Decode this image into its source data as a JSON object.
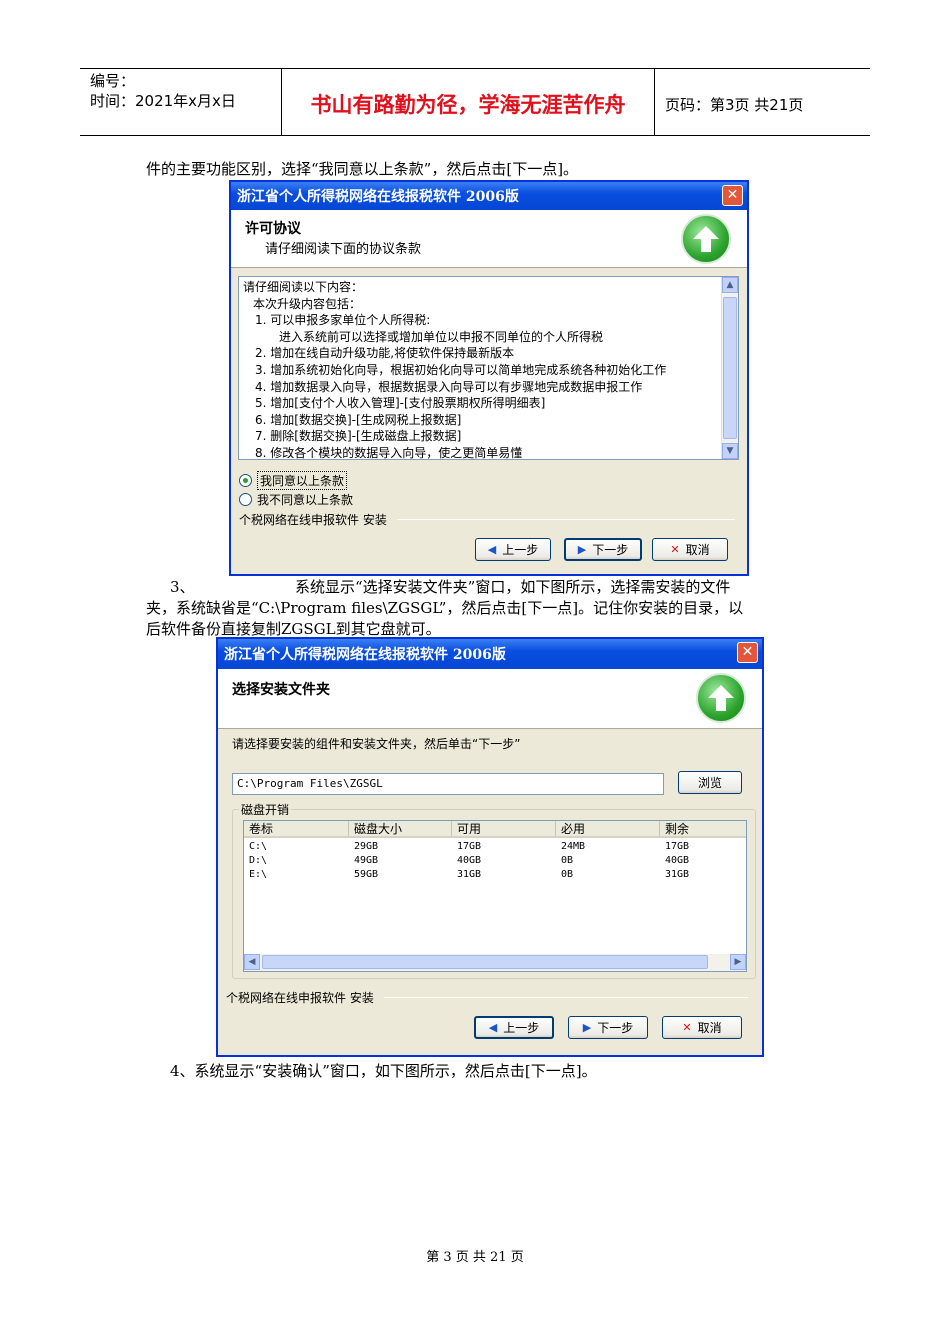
{
  "header": {
    "number_label": "编号：",
    "time_label": "时间：2021年x月x日",
    "motto": "书山有路勤为径，学海无涯苦作舟",
    "page_code": "页码：第3页  共21页"
  },
  "body": {
    "para1": "件的主要功能区别，选择“我同意以上条款”，然后点击[下一点]。",
    "step3_num": "3、",
    "step3_line1": "系统显示“选择安装文件夹”窗口，如下图所示，选择需安装的文件",
    "step3_line2": "夹，系统缺省是“C:\\Program files\\ZGSGL”，然后点击[下一点]。记住你安装的目录，以",
    "step3_line3": "后软件备份直接复制ZGSGL到其它盘就可。",
    "step4": "4、系统显示“安装确认”窗口，如下图所示，然后点击[下一点]。"
  },
  "dialog1": {
    "title": "浙江省个人所得税网络在线报税软件 2006版",
    "close": "✕",
    "heading": "许可协议",
    "subheading": "请仔细阅读下面的协议条款",
    "lines": [
      "请仔细阅读以下内容：",
      "本次升级内容包括：",
      "1. 可以申报多家单位个人所得税:",
      "进入系统前可以选择或增加单位以申报不同单位的个人所得税",
      "2. 增加在线自动升级功能,将使软件保持最新版本",
      "3. 增加系统初始化向导，根据初始化向导可以简单地完成系统各种初始化工作",
      "4. 增加数据录入向导，根据数据录入向导可以有步骤地完成数据申报工作",
      "5. 增加[支付个人收入管理]-[支付股票期权所得明细表]",
      "6. 增加[数据交换]-[生成网税上报数据]",
      "7. 删除[数据交换]-[生成磁盘上报数据]",
      "8. 修改各个模块的数据导入向导，使之更简单易懂"
    ],
    "agree": "我同意以上条款",
    "disagree": "我不同意以上条款",
    "installer_label": "个税网络在线申报软件 安装",
    "back": "上一步",
    "next": "下一步",
    "cancel": "取消"
  },
  "dialog2": {
    "title": "浙江省个人所得税网络在线报税软件 2006版",
    "close": "✕",
    "heading": "选择安装文件夹",
    "instruction": "请选择要安装的组件和安装文件夹，然后单击“下一步”",
    "path": "C:\\Program Files\\ZGSGL",
    "browse": "浏览",
    "disk_group": "磁盘开销",
    "columns": [
      "卷标",
      "磁盘大小",
      "可用",
      "必用",
      "剩余"
    ],
    "rows": [
      [
        "C:\\",
        "29GB",
        "17GB",
        "24MB",
        "17GB"
      ],
      [
        "D:\\",
        "49GB",
        "40GB",
        "0B",
        "40GB"
      ],
      [
        "E:\\",
        "59GB",
        "31GB",
        "0B",
        "31GB"
      ]
    ],
    "installer_label": "个税网络在线申报软件 安装",
    "back": "上一步",
    "next": "下一步",
    "cancel": "取消"
  },
  "footer": "第 3 页 共 21 页"
}
